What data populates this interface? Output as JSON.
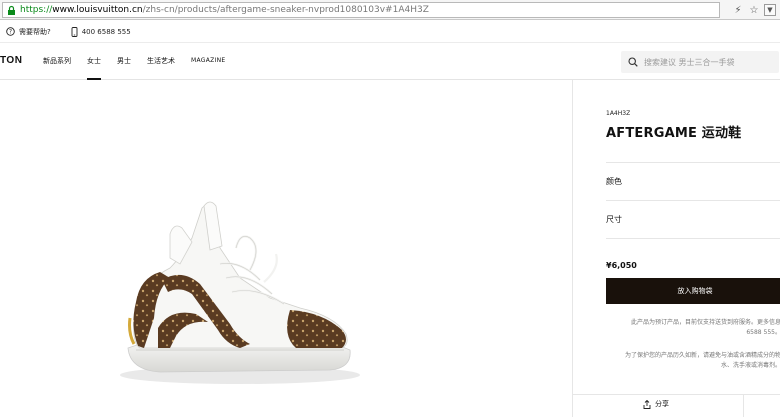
{
  "browser": {
    "url_scheme": "https://",
    "url_host": "www.louisvuitton.cn",
    "url_path": "/zhs-cn/products/aftergame-sneaker-nvprod1080103v#1A4H3Z",
    "icons": [
      "lock-icon",
      "lightning-icon",
      "star-icon",
      "dropdown-icon"
    ]
  },
  "utility": {
    "help_label": "需要帮助?",
    "phone": "400 6588 555"
  },
  "nav": {
    "logo": "TON",
    "links": [
      "新品系列",
      "女士",
      "男士",
      "生活艺术",
      "MAGAZINE"
    ],
    "active_index": 1,
    "search_placeholder": "搜索建议 男士三合一手袋"
  },
  "product": {
    "sku": "1A4H3Z",
    "title": "AFTERGAME 运动鞋",
    "color_label": "颜色",
    "size_label": "尺寸",
    "price": "¥6,050",
    "cart_label": "放入购物袋",
    "note1_line1": "此产品为预订产品，目前仅支持送货到府服务。更多信息",
    "note1_line2": "6588 555。",
    "note2_line1": "为了保护您的产品历久如新，请避免与油或含酒精成分的物",
    "note2_line2": "水、洗手液或消毒剂。",
    "share_label": "分享"
  },
  "colors": {
    "accent_dark": "#19110b",
    "url_green": "#0a8a1a"
  }
}
